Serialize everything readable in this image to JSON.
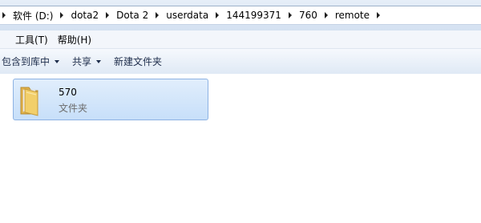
{
  "breadcrumb": {
    "items": [
      "软件 (D:)",
      "dota2",
      "Dota 2",
      "userdata",
      "144199371",
      "760",
      "remote"
    ]
  },
  "menu": {
    "items": [
      "工具(T)",
      "帮助(H)"
    ]
  },
  "commands": {
    "include_library": "包含到库中",
    "share": "共享",
    "new_folder": "新建文件夹"
  },
  "files": [
    {
      "name": "570",
      "type": "文件夹",
      "icon": "folder-icon",
      "selected": true
    }
  ],
  "colors": {
    "selection_bg": "#cce4fb",
    "selection_border": "#8db2e3",
    "folder": "#f2cf6a"
  }
}
